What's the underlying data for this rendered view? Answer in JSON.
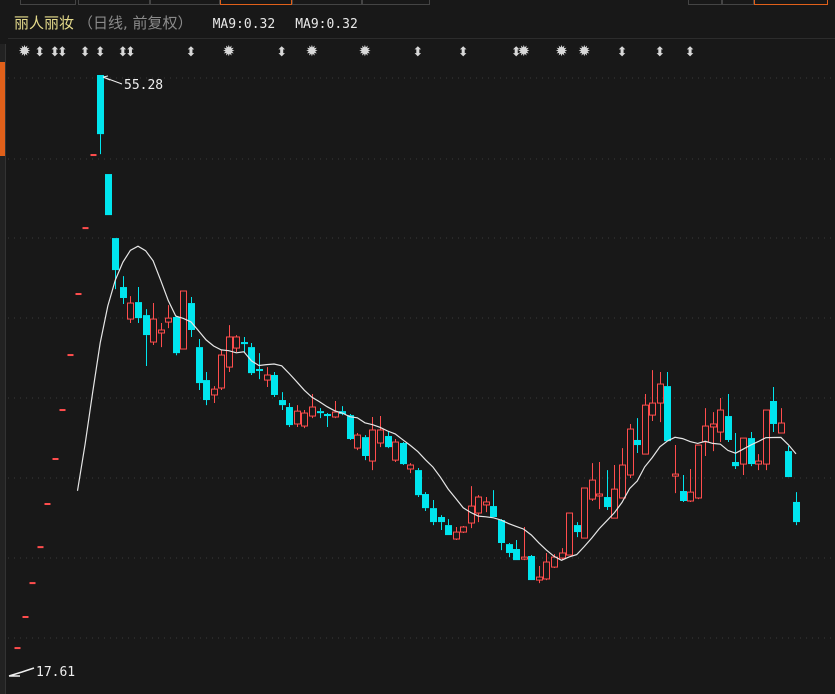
{
  "header": {
    "stock_name": "丽人丽妆",
    "period_label": "（日线, 前复权）",
    "ma_labels": [
      "MA9:0.32",
      "MA9:0.32"
    ]
  },
  "colors": {
    "up": "#ff4d4d",
    "down": "#00e5ee",
    "ma": "#e6e6e6",
    "title": "#e6dc8c",
    "accent": "#e0601a"
  },
  "chart_data": {
    "type": "candlestick",
    "title": "丽人丽妆 日线 前复权",
    "ylim": [
      17.61,
      55.28
    ],
    "annotations": {
      "high_label": "55.28",
      "low_label": "17.61"
    },
    "ma_period": 9,
    "columns": [
      "open",
      "high",
      "low",
      "close"
    ],
    "candles": [
      [
        19.12,
        19.12,
        19.12,
        19.12
      ],
      [
        21.08,
        21.08,
        21.08,
        21.08
      ],
      [
        23.22,
        23.22,
        23.22,
        23.22
      ],
      [
        25.49,
        25.49,
        25.49,
        25.49
      ],
      [
        28.21,
        28.21,
        28.21,
        28.21
      ],
      [
        31.05,
        31.05,
        31.05,
        31.05
      ],
      [
        34.14,
        34.14,
        34.14,
        34.14
      ],
      [
        37.61,
        37.61,
        37.61,
        37.61
      ],
      [
        41.46,
        41.46,
        41.46,
        41.46
      ],
      [
        45.62,
        45.62,
        45.62,
        45.62
      ],
      [
        50.23,
        50.23,
        50.23,
        50.23
      ],
      [
        55.28,
        55.28,
        50.29,
        51.55
      ],
      [
        49.03,
        49.03,
        46.44,
        46.44
      ],
      [
        44.99,
        44.99,
        41.77,
        42.97
      ],
      [
        41.9,
        42.59,
        40.83,
        41.21
      ],
      [
        39.88,
        41.33,
        39.63,
        40.89
      ],
      [
        40.95,
        41.9,
        39.63,
        39.94
      ],
      [
        40.13,
        40.51,
        36.92,
        38.87
      ],
      [
        38.43,
        40.89,
        38.24,
        39.88
      ],
      [
        39.0,
        39.63,
        38.11,
        39.19
      ],
      [
        39.69,
        40.76,
        39.31,
        39.94
      ],
      [
        40.01,
        40.1,
        37.6,
        37.73
      ],
      [
        37.99,
        41.65,
        37.99,
        41.65
      ],
      [
        40.89,
        41.27,
        38.75,
        39.19
      ],
      [
        38.11,
        38.62,
        35.4,
        35.84
      ],
      [
        36.03,
        36.54,
        34.45,
        34.77
      ],
      [
        35.09,
        35.65,
        34.58,
        35.46
      ],
      [
        35.53,
        37.92,
        35.4,
        37.61
      ],
      [
        36.85,
        39.5,
        36.54,
        38.75
      ],
      [
        38.05,
        38.87,
        37.8,
        38.75
      ],
      [
        38.43,
        38.75,
        37.8,
        38.3
      ],
      [
        38.11,
        38.37,
        36.35,
        36.47
      ],
      [
        36.73,
        37.73,
        36.09,
        36.6
      ],
      [
        36.03,
        36.85,
        35.59,
        36.35
      ],
      [
        36.35,
        36.54,
        34.96,
        35.09
      ],
      [
        34.77,
        35.27,
        34.14,
        34.45
      ],
      [
        34.33,
        34.58,
        33.07,
        33.19
      ],
      [
        33.26,
        34.45,
        33.07,
        34.07
      ],
      [
        33.13,
        34.14,
        33.0,
        33.95
      ],
      [
        33.76,
        35.15,
        33.63,
        34.33
      ],
      [
        34.07,
        34.26,
        33.63,
        33.95
      ],
      [
        33.89,
        33.95,
        33.07,
        33.76
      ],
      [
        33.7,
        34.71,
        33.63,
        34.01
      ],
      [
        34.07,
        34.39,
        33.82,
        33.89
      ],
      [
        33.82,
        33.89,
        32.25,
        32.31
      ],
      [
        31.74,
        32.69,
        31.61,
        32.56
      ],
      [
        32.43,
        32.56,
        30.98,
        31.24
      ],
      [
        30.92,
        33.7,
        30.35,
        32.88
      ],
      [
        32.06,
        33.76,
        31.8,
        32.88
      ],
      [
        32.5,
        32.75,
        31.74,
        31.8
      ],
      [
        30.98,
        32.31,
        30.86,
        32.12
      ],
      [
        32.06,
        32.12,
        30.67,
        30.73
      ],
      [
        30.42,
        30.79,
        30.16,
        30.67
      ],
      [
        30.35,
        30.48,
        28.65,
        28.77
      ],
      [
        28.84,
        28.96,
        27.77,
        27.95
      ],
      [
        27.95,
        28.46,
        26.88,
        27.07
      ],
      [
        27.39,
        27.51,
        26.57,
        27.07
      ],
      [
        26.88,
        27.26,
        26.25,
        26.25
      ],
      [
        26.0,
        26.76,
        25.94,
        26.44
      ],
      [
        26.44,
        26.82,
        26.38,
        26.76
      ],
      [
        27.01,
        29.34,
        26.69,
        28.08
      ],
      [
        27.64,
        28.77,
        27.07,
        28.65
      ],
      [
        28.15,
        28.65,
        27.7,
        28.34
      ],
      [
        28.08,
        29.09,
        27.39,
        27.39
      ],
      [
        27.2,
        27.26,
        25.3,
        25.75
      ],
      [
        25.68,
        25.75,
        24.86,
        25.12
      ],
      [
        25.37,
        25.94,
        24.67,
        24.67
      ],
      [
        24.74,
        26.76,
        24.67,
        24.86
      ],
      [
        24.93,
        24.99,
        23.41,
        23.41
      ],
      [
        23.41,
        24.3,
        23.22,
        23.6
      ],
      [
        23.48,
        25.12,
        23.41,
        24.55
      ],
      [
        24.23,
        25.05,
        24.17,
        24.86
      ],
      [
        24.8,
        25.43,
        24.67,
        25.12
      ],
      [
        24.99,
        27.64,
        24.99,
        27.64
      ],
      [
        26.88,
        27.07,
        26.12,
        26.44
      ],
      [
        26.06,
        29.22,
        26.06,
        29.22
      ],
      [
        28.52,
        30.79,
        28.4,
        29.72
      ],
      [
        28.77,
        30.86,
        27.89,
        28.84
      ],
      [
        28.65,
        30.35,
        27.83,
        28.02
      ],
      [
        27.32,
        30.67,
        27.32,
        29.15
      ],
      [
        28.59,
        31.74,
        28.59,
        30.67
      ],
      [
        30.04,
        33.26,
        29.85,
        32.94
      ],
      [
        32.25,
        33.63,
        31.43,
        31.93
      ],
      [
        31.36,
        35.15,
        31.36,
        34.45
      ],
      [
        33.82,
        36.66,
        33.45,
        34.58
      ],
      [
        34.58,
        36.54,
        33.38,
        35.78
      ],
      [
        35.65,
        36.54,
        32.18,
        32.18
      ],
      [
        29.97,
        31.93,
        28.9,
        30.1
      ],
      [
        29.03,
        30.04,
        28.34,
        28.4
      ],
      [
        28.4,
        30.42,
        28.34,
        28.96
      ],
      [
        28.59,
        31.93,
        28.52,
        31.93
      ],
      [
        32.12,
        34.26,
        31.24,
        33.13
      ],
      [
        33.07,
        34.01,
        31.55,
        33.26
      ],
      [
        32.75,
        34.9,
        32.12,
        34.14
      ],
      [
        33.76,
        35.15,
        32.12,
        32.25
      ],
      [
        30.86,
        32.69,
        30.42,
        30.6
      ],
      [
        30.73,
        32.37,
        30.04,
        32.37
      ],
      [
        32.37,
        32.75,
        30.6,
        30.73
      ],
      [
        30.73,
        31.36,
        30.35,
        30.92
      ],
      [
        30.73,
        34.14,
        30.35,
        34.14
      ],
      [
        34.71,
        35.59,
        32.75,
        33.26
      ],
      [
        32.69,
        34.26,
        32.69,
        33.32
      ],
      [
        31.55,
        31.87,
        29.91,
        29.91
      ],
      [
        28.34,
        28.96,
        26.88,
        27.07
      ]
    ],
    "event_markers": [
      {
        "index": 1,
        "type": "star"
      },
      {
        "index": 3,
        "type": "updown"
      },
      {
        "index": 5,
        "type": "updown"
      },
      {
        "index": 6,
        "type": "updown"
      },
      {
        "index": 9,
        "type": "updown"
      },
      {
        "index": 11,
        "type": "updown"
      },
      {
        "index": 14,
        "type": "updown"
      },
      {
        "index": 15,
        "type": "updown"
      },
      {
        "index": 23,
        "type": "updown"
      },
      {
        "index": 28,
        "type": "star"
      },
      {
        "index": 35,
        "type": "updown"
      },
      {
        "index": 39,
        "type": "star"
      },
      {
        "index": 46,
        "type": "star"
      },
      {
        "index": 53,
        "type": "updown"
      },
      {
        "index": 59,
        "type": "updown"
      },
      {
        "index": 66,
        "type": "updown"
      },
      {
        "index": 67,
        "type": "star"
      },
      {
        "index": 72,
        "type": "star"
      },
      {
        "index": 75,
        "type": "star"
      },
      {
        "index": 80,
        "type": "updown"
      },
      {
        "index": 85,
        "type": "updown"
      },
      {
        "index": 89,
        "type": "updown"
      }
    ]
  }
}
